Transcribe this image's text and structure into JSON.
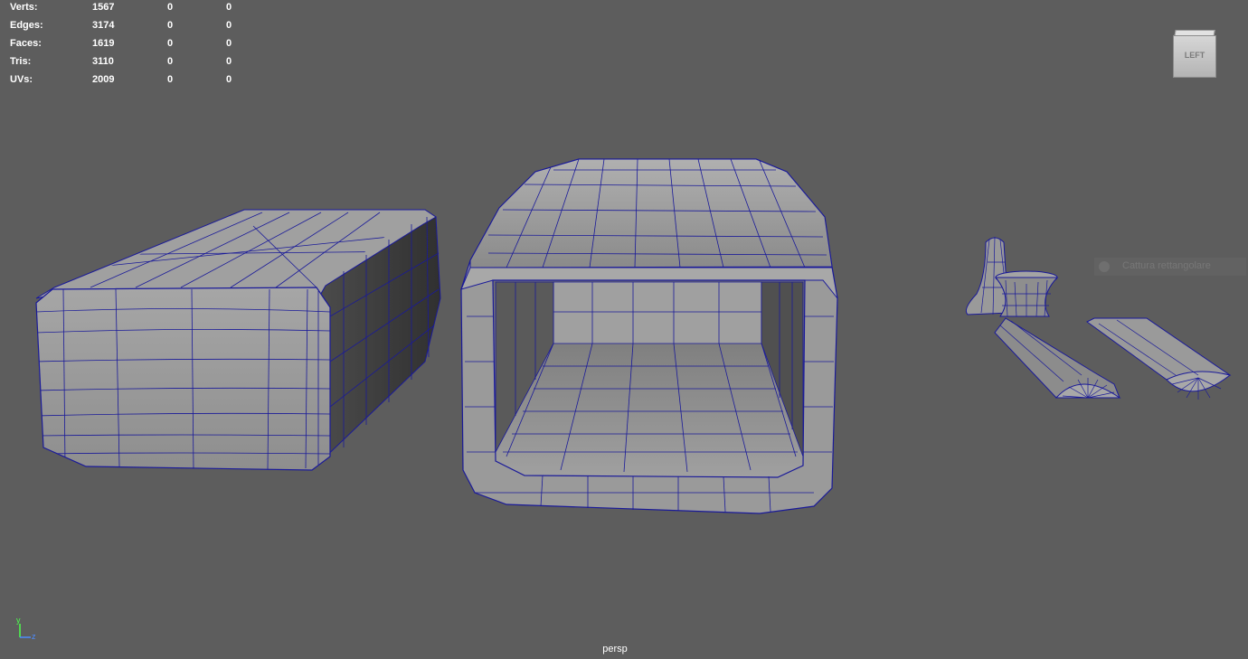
{
  "stats": {
    "rows": [
      {
        "label": "Verts:",
        "values": [
          "1567",
          "0",
          "0"
        ]
      },
      {
        "label": "Edges:",
        "values": [
          "3174",
          "0",
          "0"
        ]
      },
      {
        "label": "Faces:",
        "values": [
          "1619",
          "0",
          "0"
        ]
      },
      {
        "label": "Tris:",
        "values": [
          "3110",
          "0",
          "0"
        ]
      },
      {
        "label": "UVs:",
        "values": [
          "2009",
          "0",
          "0"
        ]
      }
    ]
  },
  "viewcube": {
    "label": "LEFT"
  },
  "tooltip": {
    "text": "Cattura rettangolare"
  },
  "axis": {
    "y": "y",
    "z": "z"
  },
  "camera": {
    "name": "persp"
  },
  "colors": {
    "background": "#5d5d5d",
    "wireframe": "#1a1a99",
    "mesh_fill": "#9c9c9c",
    "axis_y": "#4cff4c",
    "axis_z": "#4c8cff"
  }
}
